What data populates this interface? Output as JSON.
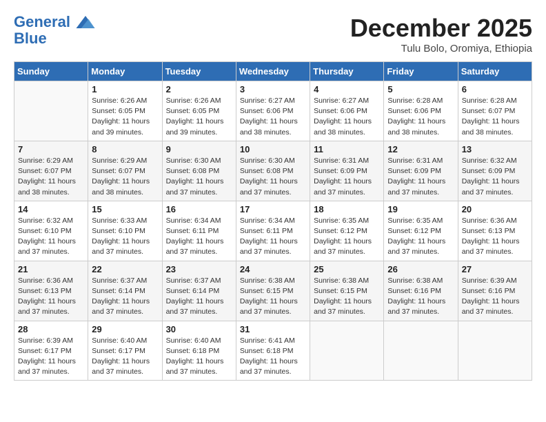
{
  "header": {
    "logo_line1": "General",
    "logo_line2": "Blue",
    "month_title": "December 2025",
    "subtitle": "Tulu Bolo, Oromiya, Ethiopia"
  },
  "weekdays": [
    "Sunday",
    "Monday",
    "Tuesday",
    "Wednesday",
    "Thursday",
    "Friday",
    "Saturday"
  ],
  "weeks": [
    [
      {
        "day": "",
        "info": ""
      },
      {
        "day": "1",
        "info": "Sunrise: 6:26 AM\nSunset: 6:05 PM\nDaylight: 11 hours\nand 39 minutes."
      },
      {
        "day": "2",
        "info": "Sunrise: 6:26 AM\nSunset: 6:05 PM\nDaylight: 11 hours\nand 39 minutes."
      },
      {
        "day": "3",
        "info": "Sunrise: 6:27 AM\nSunset: 6:06 PM\nDaylight: 11 hours\nand 38 minutes."
      },
      {
        "day": "4",
        "info": "Sunrise: 6:27 AM\nSunset: 6:06 PM\nDaylight: 11 hours\nand 38 minutes."
      },
      {
        "day": "5",
        "info": "Sunrise: 6:28 AM\nSunset: 6:06 PM\nDaylight: 11 hours\nand 38 minutes."
      },
      {
        "day": "6",
        "info": "Sunrise: 6:28 AM\nSunset: 6:07 PM\nDaylight: 11 hours\nand 38 minutes."
      }
    ],
    [
      {
        "day": "7",
        "info": "Sunrise: 6:29 AM\nSunset: 6:07 PM\nDaylight: 11 hours\nand 38 minutes."
      },
      {
        "day": "8",
        "info": "Sunrise: 6:29 AM\nSunset: 6:07 PM\nDaylight: 11 hours\nand 38 minutes."
      },
      {
        "day": "9",
        "info": "Sunrise: 6:30 AM\nSunset: 6:08 PM\nDaylight: 11 hours\nand 37 minutes."
      },
      {
        "day": "10",
        "info": "Sunrise: 6:30 AM\nSunset: 6:08 PM\nDaylight: 11 hours\nand 37 minutes."
      },
      {
        "day": "11",
        "info": "Sunrise: 6:31 AM\nSunset: 6:09 PM\nDaylight: 11 hours\nand 37 minutes."
      },
      {
        "day": "12",
        "info": "Sunrise: 6:31 AM\nSunset: 6:09 PM\nDaylight: 11 hours\nand 37 minutes."
      },
      {
        "day": "13",
        "info": "Sunrise: 6:32 AM\nSunset: 6:09 PM\nDaylight: 11 hours\nand 37 minutes."
      }
    ],
    [
      {
        "day": "14",
        "info": "Sunrise: 6:32 AM\nSunset: 6:10 PM\nDaylight: 11 hours\nand 37 minutes."
      },
      {
        "day": "15",
        "info": "Sunrise: 6:33 AM\nSunset: 6:10 PM\nDaylight: 11 hours\nand 37 minutes."
      },
      {
        "day": "16",
        "info": "Sunrise: 6:34 AM\nSunset: 6:11 PM\nDaylight: 11 hours\nand 37 minutes."
      },
      {
        "day": "17",
        "info": "Sunrise: 6:34 AM\nSunset: 6:11 PM\nDaylight: 11 hours\nand 37 minutes."
      },
      {
        "day": "18",
        "info": "Sunrise: 6:35 AM\nSunset: 6:12 PM\nDaylight: 11 hours\nand 37 minutes."
      },
      {
        "day": "19",
        "info": "Sunrise: 6:35 AM\nSunset: 6:12 PM\nDaylight: 11 hours\nand 37 minutes."
      },
      {
        "day": "20",
        "info": "Sunrise: 6:36 AM\nSunset: 6:13 PM\nDaylight: 11 hours\nand 37 minutes."
      }
    ],
    [
      {
        "day": "21",
        "info": "Sunrise: 6:36 AM\nSunset: 6:13 PM\nDaylight: 11 hours\nand 37 minutes."
      },
      {
        "day": "22",
        "info": "Sunrise: 6:37 AM\nSunset: 6:14 PM\nDaylight: 11 hours\nand 37 minutes."
      },
      {
        "day": "23",
        "info": "Sunrise: 6:37 AM\nSunset: 6:14 PM\nDaylight: 11 hours\nand 37 minutes."
      },
      {
        "day": "24",
        "info": "Sunrise: 6:38 AM\nSunset: 6:15 PM\nDaylight: 11 hours\nand 37 minutes."
      },
      {
        "day": "25",
        "info": "Sunrise: 6:38 AM\nSunset: 6:15 PM\nDaylight: 11 hours\nand 37 minutes."
      },
      {
        "day": "26",
        "info": "Sunrise: 6:38 AM\nSunset: 6:16 PM\nDaylight: 11 hours\nand 37 minutes."
      },
      {
        "day": "27",
        "info": "Sunrise: 6:39 AM\nSunset: 6:16 PM\nDaylight: 11 hours\nand 37 minutes."
      }
    ],
    [
      {
        "day": "28",
        "info": "Sunrise: 6:39 AM\nSunset: 6:17 PM\nDaylight: 11 hours\nand 37 minutes."
      },
      {
        "day": "29",
        "info": "Sunrise: 6:40 AM\nSunset: 6:17 PM\nDaylight: 11 hours\nand 37 minutes."
      },
      {
        "day": "30",
        "info": "Sunrise: 6:40 AM\nSunset: 6:18 PM\nDaylight: 11 hours\nand 37 minutes."
      },
      {
        "day": "31",
        "info": "Sunrise: 6:41 AM\nSunset: 6:18 PM\nDaylight: 11 hours\nand 37 minutes."
      },
      {
        "day": "",
        "info": ""
      },
      {
        "day": "",
        "info": ""
      },
      {
        "day": "",
        "info": ""
      }
    ]
  ]
}
